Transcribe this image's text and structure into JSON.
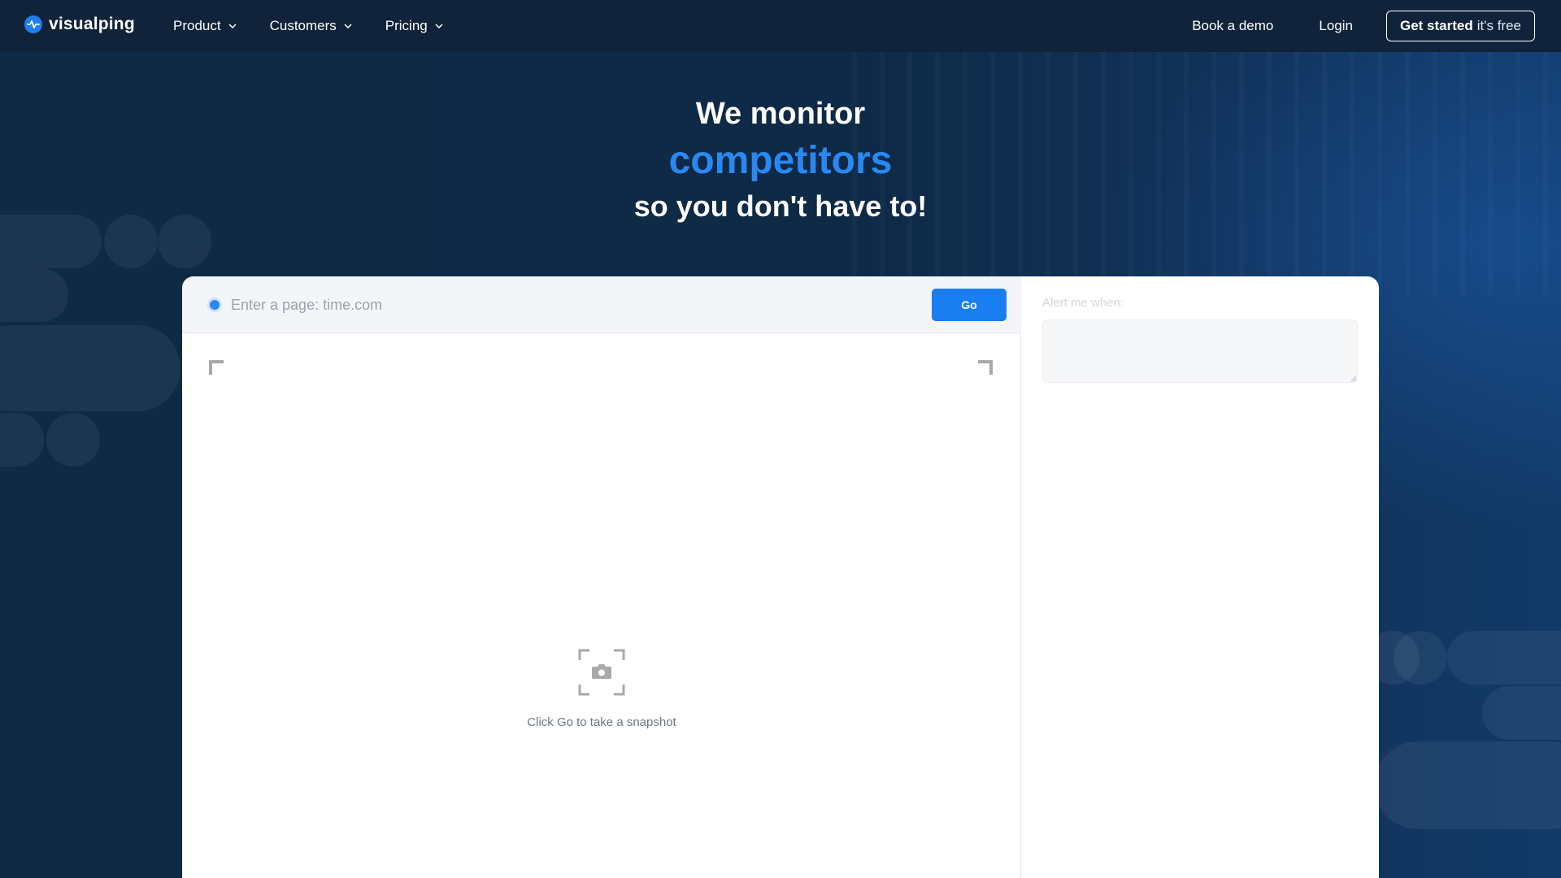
{
  "nav": {
    "brand": "visualping",
    "menu": [
      {
        "label": "Product"
      },
      {
        "label": "Customers"
      },
      {
        "label": "Pricing"
      }
    ],
    "book_demo": "Book a demo",
    "login": "Login",
    "cta_strong": "Get started",
    "cta_light": "it's free"
  },
  "hero": {
    "line1": "We monitor",
    "line2": "competitors",
    "line3": "so you don't have to!"
  },
  "monitor": {
    "url_placeholder": "Enter a page: time.com",
    "url_value": "",
    "go_label": "Go",
    "snapshot_hint": "Click Go to take a snapshot",
    "alert_label": "Alert me when:",
    "alert_value": ""
  },
  "colors": {
    "accent": "#1a7ef0",
    "highlight_text": "#2a88f2",
    "nav_bg": "#10233a",
    "page_bg": "#0d2540"
  }
}
